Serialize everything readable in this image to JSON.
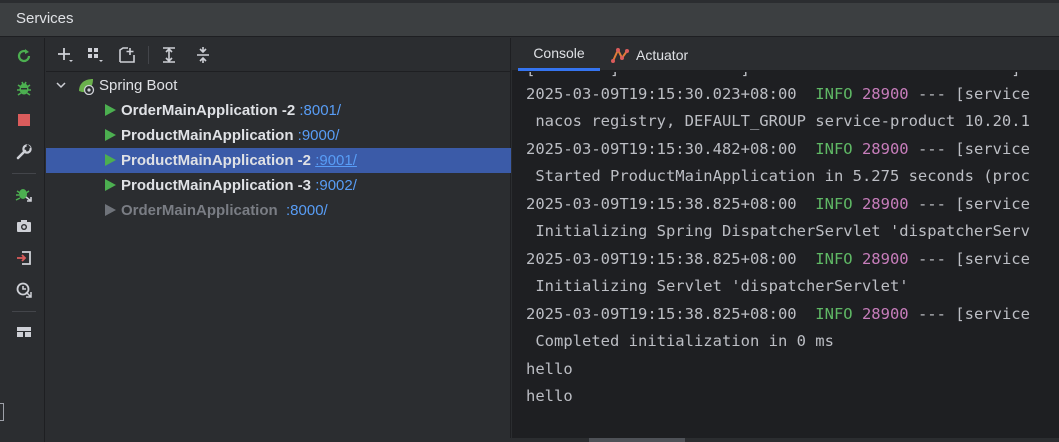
{
  "window": {
    "title": "Services"
  },
  "toolbar": {
    "icons": [
      "add-icon",
      "group-by-icon",
      "new-service-icon",
      "expand-all-icon",
      "collapse-all-icon"
    ]
  },
  "sidebar": {
    "icons": [
      "rerun-icon",
      "debug-icon",
      "stop-icon",
      "wrench-icon",
      "attach-debugger-icon",
      "camera-icon",
      "login-icon",
      "profiler-icon",
      "layout-icon"
    ]
  },
  "tree": {
    "root": {
      "label": "Spring Boot"
    },
    "items": [
      {
        "name": "OrderMainApplication -2 ",
        "port": ":8001/",
        "state": "running"
      },
      {
        "name": "ProductMainApplication ",
        "port": ":9000/",
        "state": "running"
      },
      {
        "name": "ProductMainApplication -2 ",
        "port": ":9001/",
        "state": "running",
        "selected": true
      },
      {
        "name": "ProductMainApplication -3 ",
        "port": ":9002/",
        "state": "running"
      },
      {
        "name": "OrderMainApplication  ",
        "port": ":8000/",
        "state": "stopped"
      }
    ]
  },
  "tabs": {
    "console": "Console",
    "actuator": "Actuator"
  },
  "console": {
    "partial_top": "[        ]             ]                            ]",
    "lines": [
      {
        "ts": "2025-03-09T19:15:30.023+08:00",
        "level": "INFO",
        "pid": "28900",
        "rest": " --- [service"
      },
      {
        "text": " nacos registry, DEFAULT_GROUP service-product 10.20.1"
      },
      {
        "ts": "2025-03-09T19:15:30.482+08:00",
        "level": "INFO",
        "pid": "28900",
        "rest": " --- [service"
      },
      {
        "text": " Started ProductMainApplication in 5.275 seconds (proc"
      },
      {
        "ts": "2025-03-09T19:15:38.825+08:00",
        "level": "INFO",
        "pid": "28900",
        "rest": " --- [service"
      },
      {
        "text": " Initializing Spring DispatcherServlet 'dispatcherServ"
      },
      {
        "ts": "2025-03-09T19:15:38.825+08:00",
        "level": "INFO",
        "pid": "28900",
        "rest": " --- [service"
      },
      {
        "text": " Initializing Servlet 'dispatcherServlet'"
      },
      {
        "ts": "2025-03-09T19:15:38.825+08:00",
        "level": "INFO",
        "pid": "28900",
        "rest": " --- [service"
      },
      {
        "text": " Completed initialization in 0 ms"
      },
      {
        "text": "hello"
      },
      {
        "text": "hello"
      }
    ]
  },
  "colors": {
    "accent": "#3574f0",
    "selected_row": "#3b5ba8",
    "run_green": "#4caf50",
    "info_green": "#5fb865",
    "pid_magenta": "#c77dbb",
    "port_blue": "#589df6",
    "stop_red": "#db5c5c"
  }
}
